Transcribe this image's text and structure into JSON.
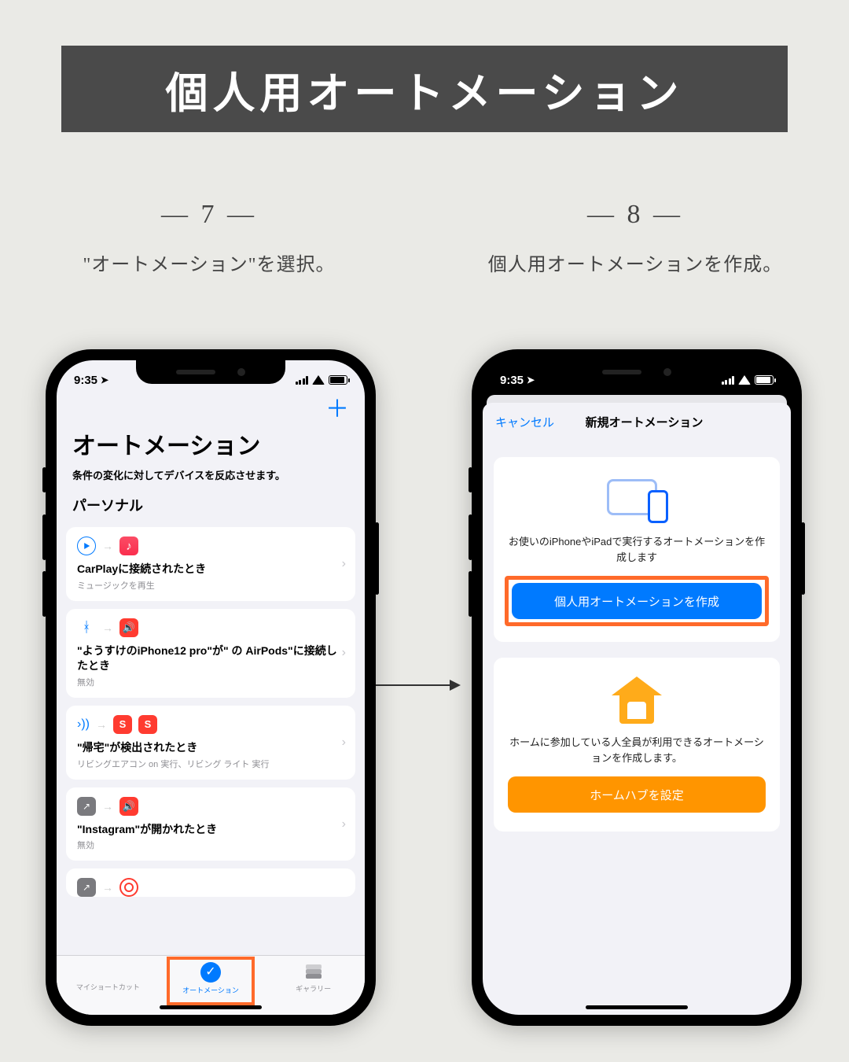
{
  "title": "個人用オートメーション",
  "steps": {
    "s7": {
      "num": "— 7 —",
      "caption": "\"オートメーション\"を選択。"
    },
    "s8": {
      "num": "— 8 —",
      "caption": "個人用オートメーションを作成。"
    }
  },
  "status": {
    "time": "9:35"
  },
  "phoneLeft": {
    "plus": "＋",
    "title": "オートメーション",
    "subtitle": "条件の変化に対してデバイスを反応させます。",
    "section": "パーソナル",
    "cards": [
      {
        "title": "CarPlayに接続されたとき",
        "sub": "ミュージックを再生"
      },
      {
        "title": "\"ようすけのiPhone12 pro\"が\"      の AirPods\"に接続したとき",
        "sub": "無効"
      },
      {
        "title": "\"帰宅\"が検出されたとき",
        "sub": "リビングエアコン on 実行、リビング ライト 実行"
      },
      {
        "title": "\"Instagram\"が開かれたとき",
        "sub": "無効"
      }
    ],
    "tabs": {
      "shortcuts": "マイショートカット",
      "automation": "オートメーション",
      "gallery": "ギャラリー"
    }
  },
  "phoneRight": {
    "cancel": "キャンセル",
    "sheetTitle": "新規オートメーション",
    "card1desc": "お使いのiPhoneやiPadで実行するオートメーションを作成します",
    "card1btn": "個人用オートメーションを作成",
    "card2desc": "ホームに参加している人全員が利用できるオートメーションを作成します。",
    "card2btn": "ホームハブを設定"
  }
}
